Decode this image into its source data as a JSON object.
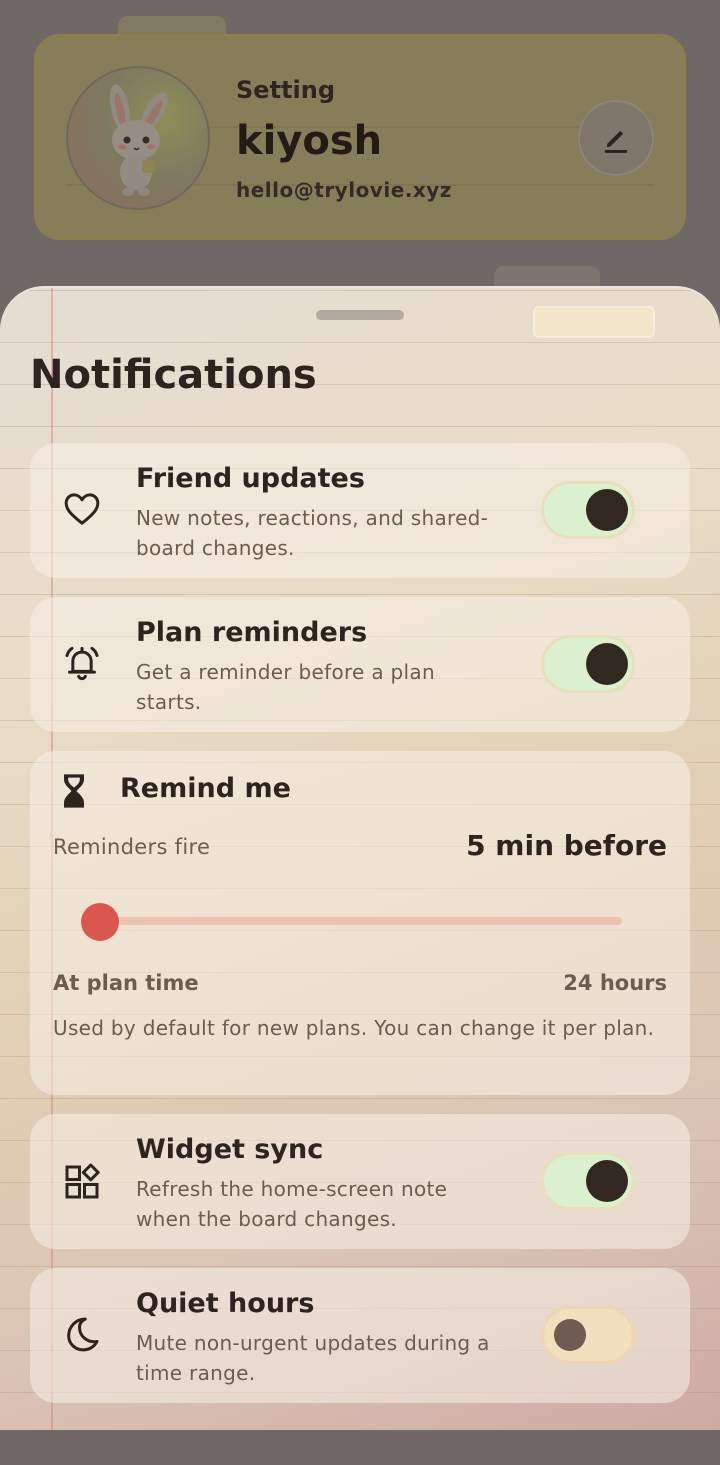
{
  "profile": {
    "kicker": "Setting",
    "name": "kiyosh",
    "email": "hello@trylovie.xyz",
    "edit_icon": "pencil-icon"
  },
  "sheet": {
    "title": "Notifications"
  },
  "settings": [
    {
      "title": "Friend updates",
      "description": "New notes, reactions, and shared-board changes.",
      "icon": "heart-icon",
      "enabled": true
    },
    {
      "title": "Plan reminders",
      "description": "Get a reminder before a plan starts.",
      "icon": "bell-icon",
      "enabled": true
    },
    {
      "title": "Widget sync",
      "description": "Refresh the home-screen note when the board changes.",
      "icon": "widgets-icon",
      "enabled": true
    },
    {
      "title": "Quiet hours",
      "description": "Mute non-urgent updates during a time range.",
      "icon": "moon-icon",
      "enabled": false
    }
  ],
  "remind": {
    "title": "Remind me",
    "icon": "hourglass-icon",
    "label": "Reminders fire",
    "value": "5 min before",
    "slider_level": 0,
    "min_label": "At plan time",
    "max_label": "24 hours",
    "note": "Used by default for new plans. You can change it per plan."
  },
  "colors": {
    "accent": "#d9574c",
    "toggle_on": "#dbf0ce",
    "toggle_off": "#f1dfbd",
    "knob": "#33281f"
  }
}
